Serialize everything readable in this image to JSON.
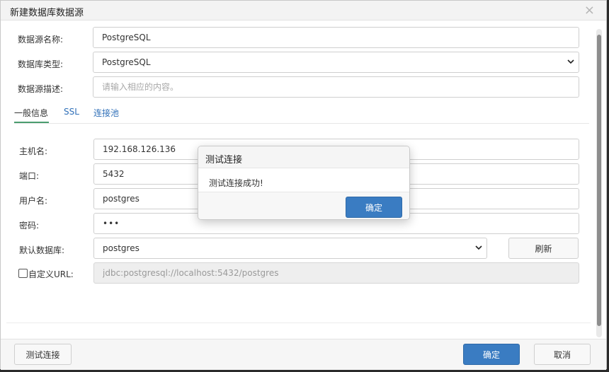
{
  "dialog": {
    "title": "新建数据库数据源",
    "close_glyph": "×"
  },
  "form": {
    "name_label": "数据源名称:",
    "name_value": "PostgreSQL",
    "type_label": "数据库类型:",
    "type_value": "PostgreSQL",
    "desc_label": "数据源描述:",
    "desc_placeholder": "请输入相应的内容。"
  },
  "tabs": [
    {
      "label": "一般信息",
      "active": true
    },
    {
      "label": "SSL",
      "active": false
    },
    {
      "label": "连接池",
      "active": false
    }
  ],
  "general": {
    "host_label": "主机名:",
    "host_value": "192.168.126.136",
    "port_label": "端口:",
    "port_value": "5432",
    "user_label": "用户名:",
    "user_value": "postgres",
    "password_label": "密码:",
    "password_value": "•••",
    "default_db_label": "默认数据库:",
    "default_db_value": "postgres",
    "refresh_label": "刷新",
    "custom_url_label": "自定义URL:",
    "custom_url_checked": false,
    "custom_url_value": "jdbc:postgresql://localhost:5432/postgres"
  },
  "footer": {
    "test_label": "测试连接",
    "ok_label": "确定",
    "cancel_label": "取消"
  },
  "popup": {
    "title": "测试连接",
    "message": "测试连接成功!",
    "ok_label": "确定"
  },
  "colors": {
    "primary": "#3a7cc2",
    "tab_active_underline": "#4a9d6f",
    "link": "#2f6fb8"
  },
  "icons": [
    "close-icon",
    "chevron-down-icon",
    "checkbox"
  ]
}
